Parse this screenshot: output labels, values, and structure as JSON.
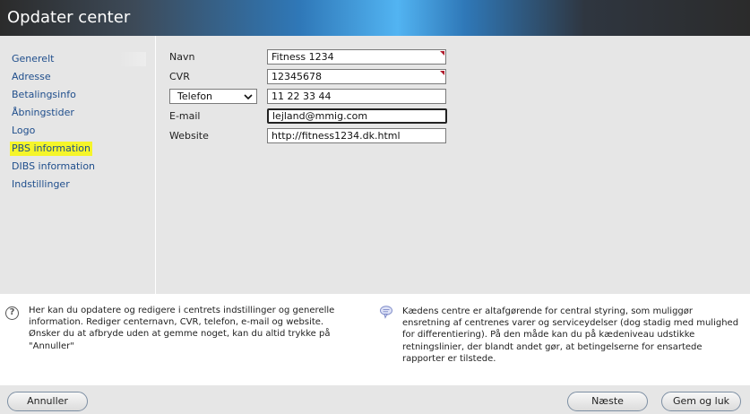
{
  "window": {
    "title": "Opdater center"
  },
  "sidebar": {
    "items": [
      {
        "label": "Generelt"
      },
      {
        "label": "Adresse"
      },
      {
        "label": "Betalingsinfo"
      },
      {
        "label": "Åbningstider"
      },
      {
        "label": "Logo"
      },
      {
        "label": "PBS information"
      },
      {
        "label": "DIBS information"
      },
      {
        "label": "Indstillinger"
      }
    ]
  },
  "form": {
    "name": {
      "label": "Navn",
      "value": "Fitness 1234"
    },
    "cvr": {
      "label": "CVR",
      "value": "12345678"
    },
    "phone": {
      "select_value": "Telefon",
      "value": "11 22 33 44"
    },
    "email": {
      "label": "E-mail",
      "value": "lejland@mmig.com"
    },
    "website": {
      "label": "Website",
      "value": "http://fitness1234.dk.html"
    }
  },
  "info": {
    "help_text": "Her kan du opdatere og redigere i centrets indstillinger og generelle information. Rediger centernavn, CVR, telefon, e-mail og website. Ønsker du at afbryde uden at gemme noget, kan du altid trykke på \"Annuller\"",
    "tip_text": "Kædens centre er altafgørende for central styring, som muliggør ensretning af centrenes varer og serviceydelser (dog stadig med mulighed for differentiering). På den måde kan du på kædeniveau udstikke retningslinier, der blandt andet gør, at betingelserne for ensartede rapporter er tilstede."
  },
  "footer": {
    "cancel_label": "Annuller",
    "next_label": "Næste",
    "save_close_label": "Gem og luk"
  },
  "colors": {
    "link": "#1f4e8c",
    "highlight": "#f5f52a",
    "required_marker": "#b01c2c"
  }
}
